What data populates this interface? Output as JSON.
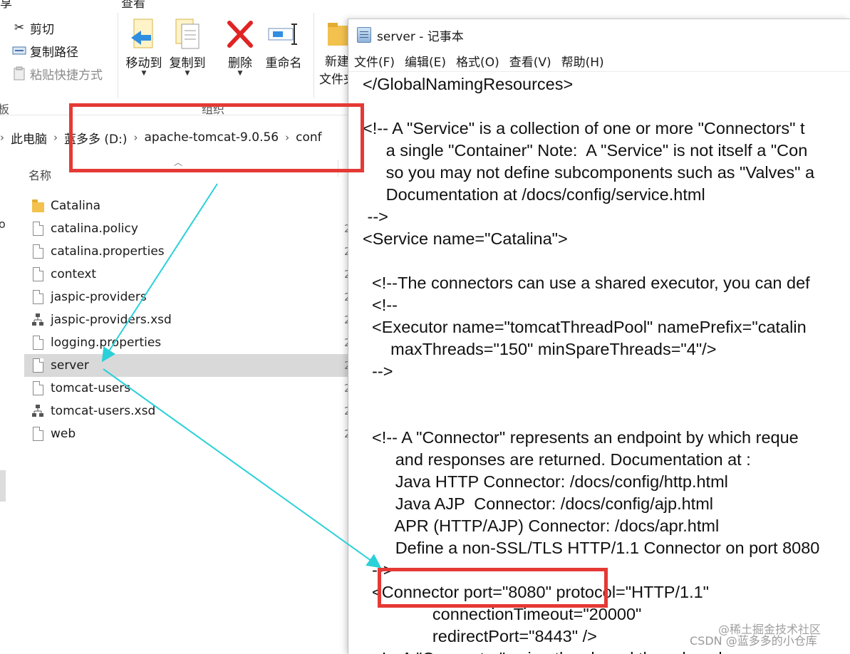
{
  "ribbon": {
    "top_cut_left": "享",
    "top_cut_mid": "查看",
    "clipboard": {
      "cut_label": "剪切",
      "copy_path_label": "复制路径",
      "paste_shortcut_label": "粘贴快捷方式",
      "group_label_cut": "板"
    },
    "organize": {
      "move_to_label": "移动到",
      "copy_to_label": "复制到",
      "delete_label": "删除",
      "rename_label": "重命名",
      "group_label": "组织"
    },
    "new_cut_label1": "新建",
    "new_cut_label2": "文件夹"
  },
  "address": {
    "segments": [
      "此电脑",
      "蓝多多 (D:)",
      "apache-tomcat-9.0.56",
      "conf"
    ]
  },
  "file_list": {
    "column_name": "名称",
    "left_char": "o",
    "files": [
      {
        "name": "Catalina",
        "type": "folder"
      },
      {
        "name": "catalina.policy",
        "type": "file"
      },
      {
        "name": "catalina.properties",
        "type": "file"
      },
      {
        "name": "context",
        "type": "file"
      },
      {
        "name": "jaspic-providers",
        "type": "file"
      },
      {
        "name": "jaspic-providers.xsd",
        "type": "xsd"
      },
      {
        "name": "logging.properties",
        "type": "file"
      },
      {
        "name": "server",
        "type": "file",
        "selected": true
      },
      {
        "name": "tomcat-users",
        "type": "file"
      },
      {
        "name": "tomcat-users.xsd",
        "type": "xsd"
      },
      {
        "name": "web",
        "type": "file"
      }
    ],
    "date_cut": "2"
  },
  "notepad": {
    "title": "server - 记事本",
    "menu": [
      "文件(F)",
      "编辑(E)",
      "格式(O)",
      "查看(V)",
      "帮助(H)"
    ],
    "lines": [
      "</GlobalNamingResources>",
      "",
      "<!-- A \"Service\" is a collection of one or more \"Connectors\" t",
      "     a single \"Container\" Note:  A \"Service\" is not itself a \"Con",
      "     so you may not define subcomponents such as \"Valves\" a",
      "     Documentation at /docs/config/service.html",
      " -->",
      "<Service name=\"Catalina\">",
      "",
      "  <!--The connectors can use a shared executor, you can def",
      "  <!--",
      "  <Executor name=\"tomcatThreadPool\" namePrefix=\"catalin",
      "      maxThreads=\"150\" minSpareThreads=\"4\"/>",
      "  -->",
      "",
      "",
      "  <!-- A \"Connector\" represents an endpoint by which reque",
      "       and responses are returned. Documentation at :",
      "       Java HTTP Connector: /docs/config/http.html",
      "       Java AJP  Connector: /docs/config/ajp.html",
      "       APR (HTTP/AJP) Connector: /docs/apr.html",
      "       Define a non-SSL/TLS HTTP/1.1 Connector on port 8080",
      "  -->",
      "  <Connector port=\"8080\" protocol=\"HTTP/1.1\"",
      "               connectionTimeout=\"20000\"",
      "               redirectPort=\"8443\" />",
      "  <!-- A \"Connector\" using the shared thread pool-->"
    ]
  },
  "watermark": {
    "line1": "@稀土掘金技术社区",
    "line2": "CSDN @蓝多多的小仓库"
  },
  "colors": {
    "annotation_red": "#e53935",
    "annotation_arrow": "#2ad1d8",
    "selection_gray": "#d9d9d9"
  }
}
